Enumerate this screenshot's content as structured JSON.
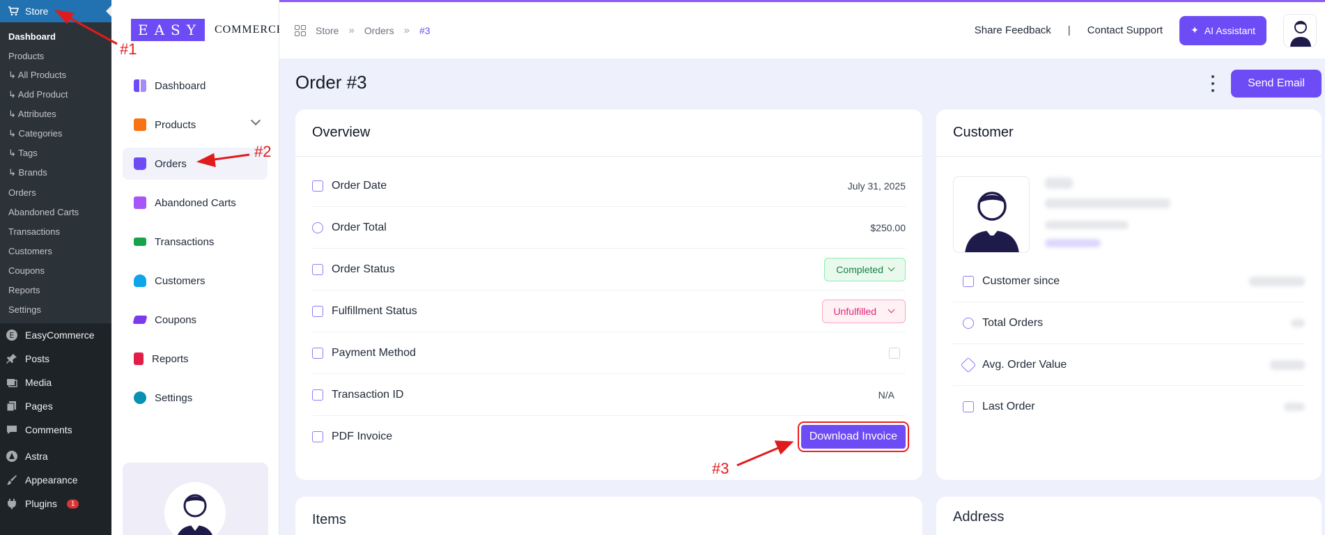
{
  "wp": {
    "store_label": "Store",
    "submenu": [
      "Dashboard",
      "Products",
      "↳ All Products",
      "↳ Add Product",
      "↳ Attributes",
      "↳ Categories",
      "↳ Tags",
      "↳ Brands",
      "Orders",
      "Abandoned Carts",
      "Transactions",
      "Customers",
      "Coupons",
      "Reports",
      "Settings"
    ],
    "menu": [
      {
        "label": "EasyCommerce",
        "icon": "easycommerce-icon"
      },
      {
        "label": "Posts",
        "icon": "pin-icon"
      },
      {
        "label": "Media",
        "icon": "media-icon"
      },
      {
        "label": "Pages",
        "icon": "pages-icon"
      },
      {
        "label": "Comments",
        "icon": "comment-icon"
      },
      {
        "label": "Astra",
        "icon": "astra-icon"
      },
      {
        "label": "Appearance",
        "icon": "brush-icon"
      },
      {
        "label": "Plugins",
        "icon": "plug-icon",
        "badge": "1"
      }
    ]
  },
  "brand": {
    "box": "EASY",
    "word": "COMMERCE"
  },
  "nav": [
    {
      "label": "Dashboard",
      "color": "#6d4cf5"
    },
    {
      "label": "Products",
      "color": "#f97316"
    },
    {
      "label": "Orders",
      "color": "#6d4cf5"
    },
    {
      "label": "Abandoned Carts",
      "color": "#a855f7"
    },
    {
      "label": "Transactions",
      "color": "#16a34a"
    },
    {
      "label": "Customers",
      "color": "#0ea5e9"
    },
    {
      "label": "Coupons",
      "color": "#7c3aed"
    },
    {
      "label": "Reports",
      "color": "#e11d48"
    },
    {
      "label": "Settings",
      "color": "#0891b2"
    }
  ],
  "breadcrumb": [
    "Store",
    "Orders",
    "#3"
  ],
  "topbar": {
    "share": "Share Feedback",
    "sep": "|",
    "contact": "Contact Support",
    "ai": "AI Assistant"
  },
  "page": {
    "title": "Order #3",
    "send_email": "Send Email"
  },
  "overview": {
    "title": "Overview",
    "rows": {
      "order_date": {
        "label": "Order Date",
        "value": "July 31, 2025"
      },
      "order_total": {
        "label": "Order Total",
        "value": "$250.00"
      },
      "order_status": {
        "label": "Order Status",
        "value": "Completed"
      },
      "fulfillment": {
        "label": "Fulfillment Status",
        "value": "Unfulfilled"
      },
      "payment": {
        "label": "Payment Method"
      },
      "transaction": {
        "label": "Transaction ID",
        "value": "N/A"
      },
      "invoice": {
        "label": "PDF Invoice",
        "button": "Download Invoice"
      }
    }
  },
  "customer": {
    "title": "Customer",
    "rows": [
      "Customer since",
      "Total Orders",
      "Avg. Order Value",
      "Last Order"
    ]
  },
  "items": {
    "title": "Items"
  },
  "address": {
    "title": "Address"
  },
  "annotations": [
    "#1",
    "#2",
    "#3"
  ],
  "colors": {
    "accent": "#6d4cf5",
    "wp_dark": "#1d2327",
    "wp_blue": "#2271b1",
    "annotation": "#e01b1b"
  }
}
